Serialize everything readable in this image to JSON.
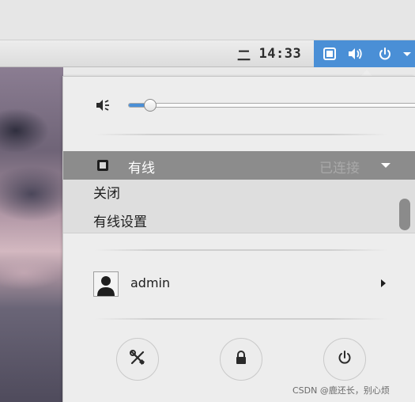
{
  "topbar": {
    "clock_day": "二",
    "clock_time": "14:33",
    "status_icons": [
      "network-icon",
      "volume-icon",
      "power-icon",
      "chevron-down-icon"
    ]
  },
  "menu": {
    "volume": {
      "icon": "volume-muted-icon",
      "level": 0.05
    },
    "wired": {
      "label": "有线",
      "status": "已连接"
    },
    "submenu": {
      "items": [
        "关闭",
        "有线设置"
      ]
    },
    "user": {
      "name": "admin"
    },
    "actions": [
      "settings-icon",
      "lock-icon",
      "power-icon"
    ]
  },
  "watermark": "CSDN @鹿还长，别心烦",
  "colors": {
    "accent": "#4a8fd6",
    "highlight_row": "#8c8c8c",
    "menu_bg": "#ededed"
  }
}
